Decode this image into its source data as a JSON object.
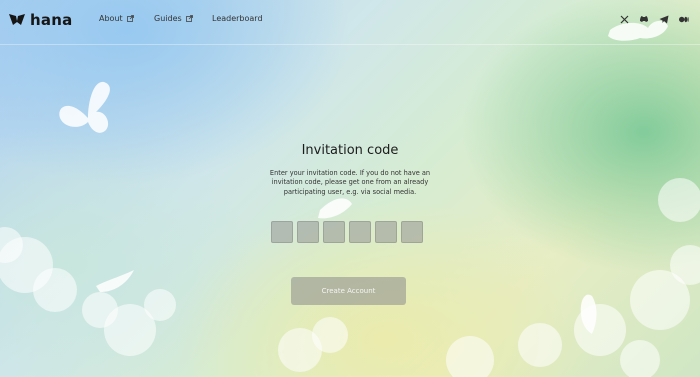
{
  "brand": {
    "name": "hana"
  },
  "nav": {
    "items": [
      {
        "label": "About",
        "icon": "external-link-icon"
      },
      {
        "label": "Guides",
        "icon": "external-link-icon"
      },
      {
        "label": "Leaderboard"
      }
    ]
  },
  "socials": [
    "x-icon",
    "discord-icon",
    "telegram-icon",
    "medium-icon"
  ],
  "invite": {
    "title": "Invitation code",
    "description": "Enter your invitation code. If you do not have an invitation code, please get one from an already participating user, e.g. via social media.",
    "code_boxes": [
      "",
      "",
      "",
      "",
      "",
      ""
    ],
    "submit_label": "Create Account"
  },
  "colors": {
    "code_box": "#9a9a9a",
    "button": "#8c8c8c",
    "text_dark": "#1c1c1c"
  }
}
